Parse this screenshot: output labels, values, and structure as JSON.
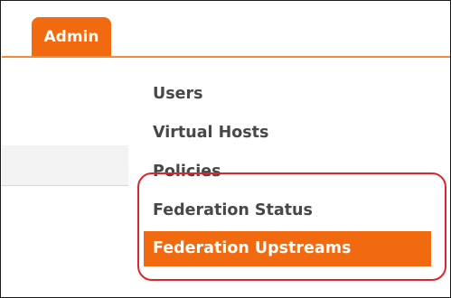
{
  "nav": {
    "admin_tab_label": "Admin"
  },
  "admin_menu": {
    "items": [
      {
        "label": "Users"
      },
      {
        "label": "Virtual Hosts"
      },
      {
        "label": "Policies"
      },
      {
        "label": "Federation Status"
      },
      {
        "label": "Federation Upstreams"
      }
    ],
    "active_index": 4
  },
  "colors": {
    "accent": "#f26a0f",
    "highlight_outline": "#e0242b",
    "menu_text": "#484848"
  }
}
